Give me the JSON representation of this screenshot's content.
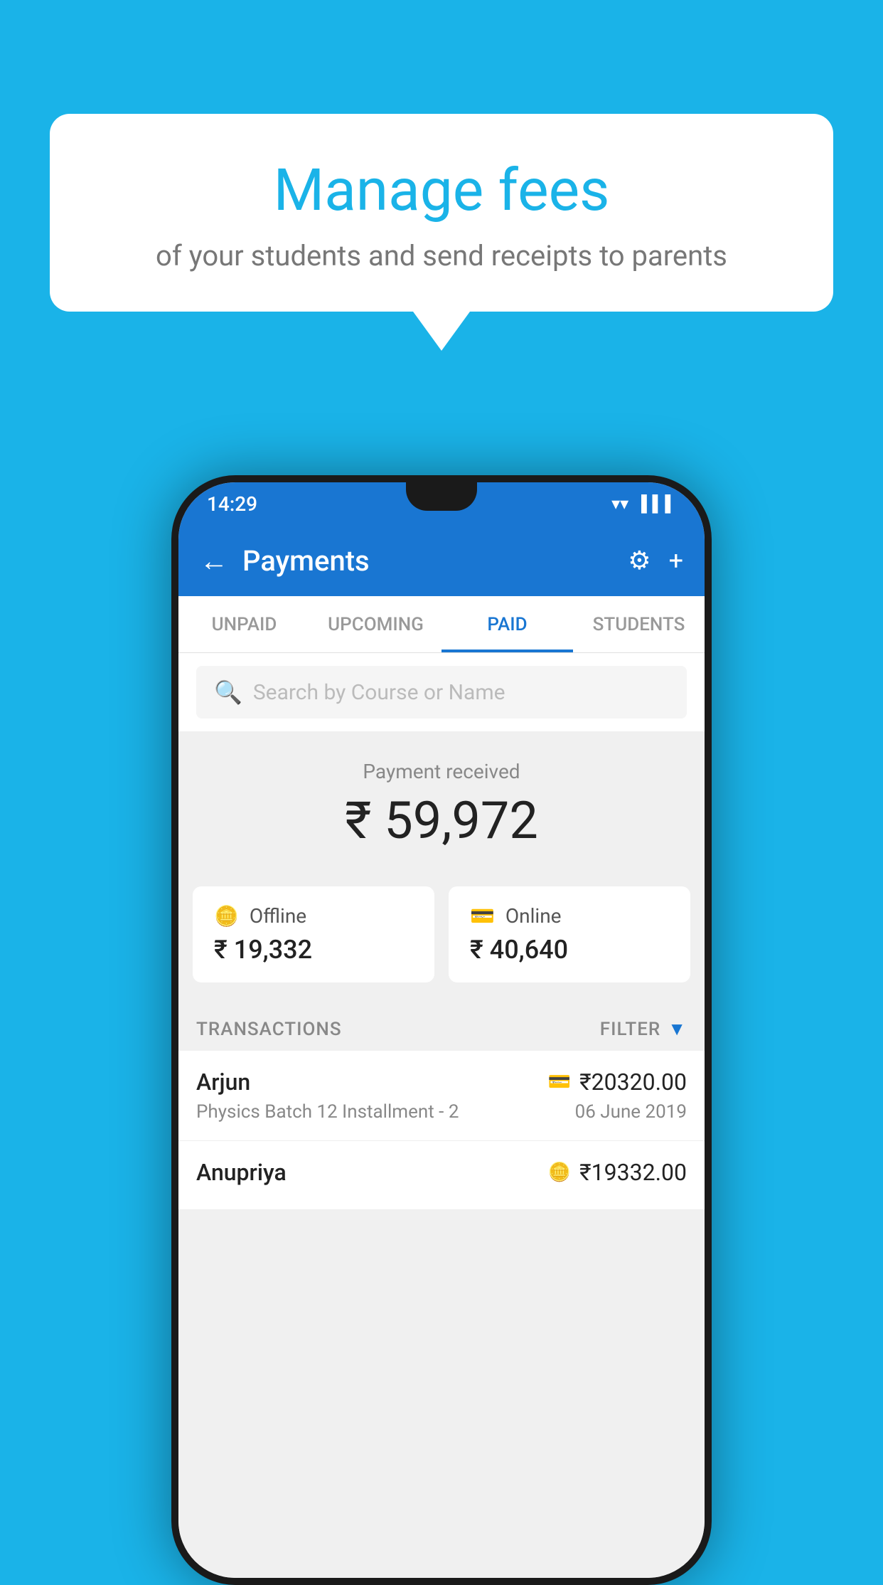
{
  "background_color": "#1ab3e8",
  "speech_bubble": {
    "title": "Manage fees",
    "subtitle": "of your students and send receipts to parents"
  },
  "status_bar": {
    "time": "14:29"
  },
  "app_bar": {
    "title": "Payments",
    "back_label": "←",
    "settings_label": "⚙",
    "add_label": "+"
  },
  "tabs": [
    {
      "label": "UNPAID",
      "active": false
    },
    {
      "label": "UPCOMING",
      "active": false
    },
    {
      "label": "PAID",
      "active": true
    },
    {
      "label": "STUDENTS",
      "active": false
    }
  ],
  "search": {
    "placeholder": "Search by Course or Name"
  },
  "payment_received": {
    "label": "Payment received",
    "amount": "₹ 59,972"
  },
  "payment_methods": [
    {
      "label": "Offline",
      "amount": "₹ 19,332",
      "icon": "💳"
    },
    {
      "label": "Online",
      "amount": "₹ 40,640",
      "icon": "💳"
    }
  ],
  "transactions_header": {
    "label": "TRANSACTIONS",
    "filter_label": "FILTER"
  },
  "transactions": [
    {
      "name": "Arjun",
      "course": "Physics Batch 12 Installment - 2",
      "amount": "₹20320.00",
      "date": "06 June 2019",
      "type": "online"
    },
    {
      "name": "Anupriya",
      "course": "",
      "amount": "₹19332.00",
      "date": "",
      "type": "offline"
    }
  ]
}
